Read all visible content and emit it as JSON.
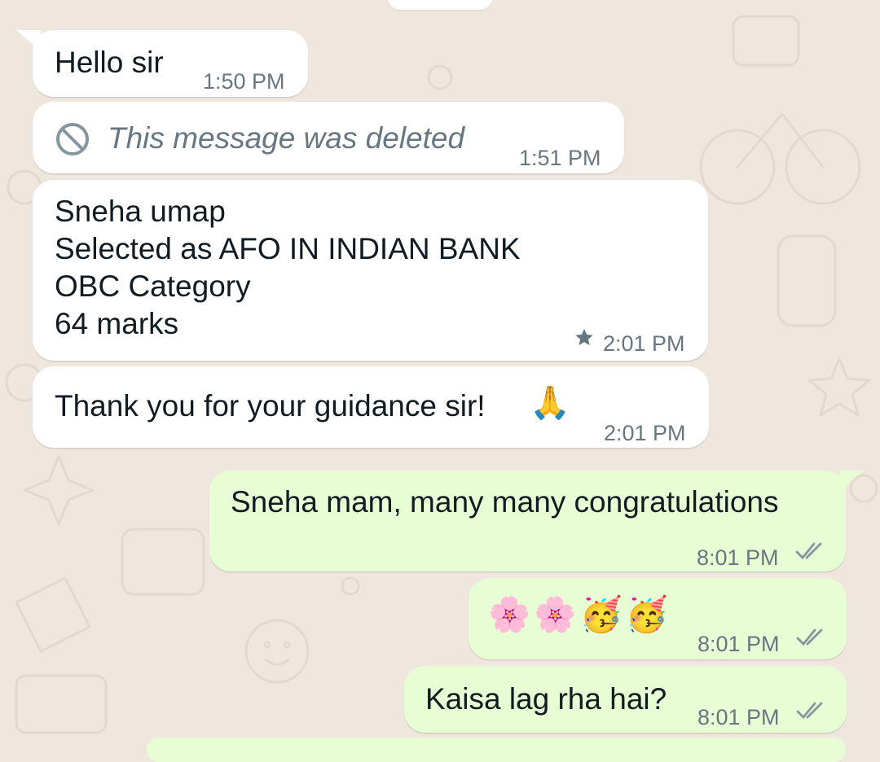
{
  "chat": {
    "messages": [
      {
        "direction": "incoming",
        "text": "Hello sir",
        "time": "1:50 PM"
      },
      {
        "direction": "incoming",
        "deleted": true,
        "text": "This message was deleted",
        "time": "1:51 PM",
        "icon": "blocked-icon"
      },
      {
        "direction": "incoming",
        "lines": [
          "Sneha umap",
          "Selected as AFO IN INDIAN BANK",
          "OBC Category",
          "64 marks"
        ],
        "time": "2:01 PM",
        "starred": true,
        "icon": "star-icon"
      },
      {
        "direction": "incoming",
        "text": "Thank you for your guidance sir!",
        "emoji": "🙏",
        "time": "2:01 PM"
      },
      {
        "direction": "outgoing",
        "text": "Sneha mam, many many congratulations",
        "time": "8:01 PM",
        "status": "read",
        "icon": "double-check-icon"
      },
      {
        "direction": "outgoing",
        "emoji": "🌸🌸🥳🥳",
        "time": "8:01 PM",
        "status": "read",
        "icon": "double-check-icon"
      },
      {
        "direction": "outgoing",
        "text": "Kaisa lag rha hai?",
        "time": "8:01 PM",
        "status": "read",
        "icon": "double-check-icon"
      }
    ]
  },
  "colors": {
    "background": "#efe7de",
    "incoming_bubble": "#ffffff",
    "outgoing_bubble": "#e7fdd3",
    "meta_text": "#667781",
    "deleted_text": "#667781"
  }
}
